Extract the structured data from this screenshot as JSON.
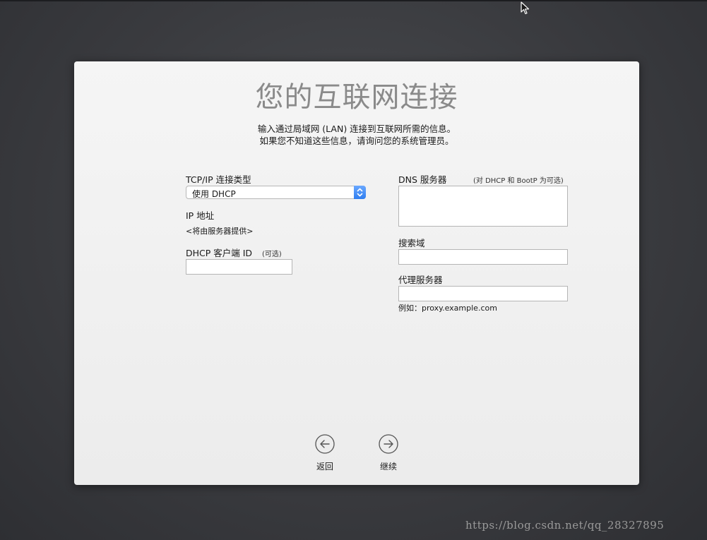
{
  "page": {
    "title": "您的互联网连接",
    "subtitle_line1": "输入通过局域网 (LAN) 连接到互联网所需的信息。",
    "subtitle_line2": "如果您不知道这些信息，请询问您的系统管理员。"
  },
  "left": {
    "tcpip_label": "TCP/IP 连接类型",
    "tcpip_selected": "使用 DHCP",
    "ip_label": "IP 地址",
    "ip_value": "<将由服务器提供>",
    "dhcp_client_label": "DHCP 客户端 ID",
    "dhcp_client_optional": "(可选)",
    "dhcp_client_value": ""
  },
  "right": {
    "dns_label": "DNS 服务器",
    "dns_note": "(对 DHCP 和 BootP 为可选)",
    "dns_value": "",
    "search_label": "搜索域",
    "search_value": "",
    "proxy_label": "代理服务器",
    "proxy_value": "",
    "proxy_example": "例如：proxy.example.com"
  },
  "nav": {
    "back_label": "返回",
    "continue_label": "继续"
  },
  "icons": {
    "back": "arrow-left-circle-icon",
    "continue": "arrow-right-circle-icon",
    "select": "up-down-chevron-icon",
    "cursor": "mouse-pointer-icon"
  },
  "colors": {
    "accent": "#3a85f5",
    "background": "#3a3b3f",
    "panel": "#efefef",
    "title": "#8a8a8a"
  },
  "watermark": "https://blog.csdn.net/qq_28327895"
}
